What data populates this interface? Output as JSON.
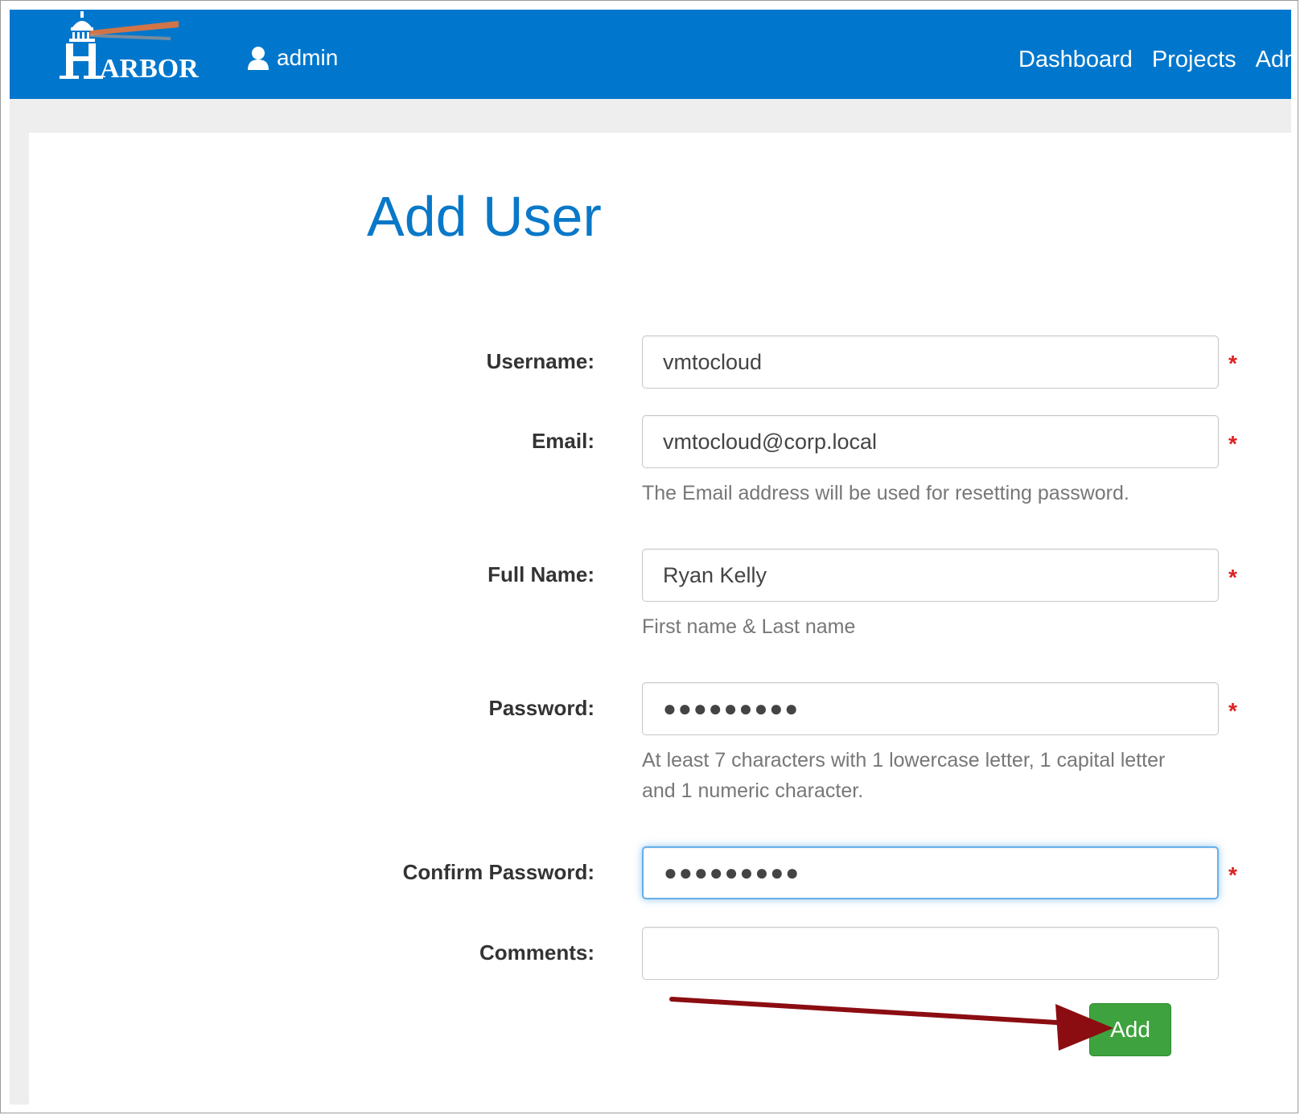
{
  "header": {
    "logo_text": "HARBOR",
    "user": {
      "icon": "user-icon",
      "name": "admin"
    },
    "nav": [
      "Dashboard",
      "Projects",
      "Adm"
    ]
  },
  "page": {
    "title": "Add User"
  },
  "form": {
    "username": {
      "label": "Username:",
      "value": "vmtocloud",
      "required": "*"
    },
    "email": {
      "label": "Email:",
      "value": "vmtocloud@corp.local",
      "required": "*",
      "help": "The Email address will be used for resetting password."
    },
    "full_name": {
      "label": "Full Name:",
      "value": "Ryan Kelly",
      "required": "*",
      "help": "First name & Last name"
    },
    "password": {
      "label": "Password:",
      "value": "●●●●●●●●●",
      "required": "*",
      "help_line1": "At least 7 characters with 1 lowercase letter, 1 capital letter",
      "help_line2": "and 1 numeric character."
    },
    "confirm_password": {
      "label": "Confirm Password:",
      "value": "●●●●●●●●●",
      "required": "*"
    },
    "comments": {
      "label": "Comments:",
      "value": ""
    },
    "submit_label": "Add"
  },
  "colors": {
    "navbar": "#0077cc",
    "title": "#0a78c8",
    "add_button": "#3ea33e",
    "required": "#dd2222",
    "annotation_arrow": "#8b0d12"
  }
}
